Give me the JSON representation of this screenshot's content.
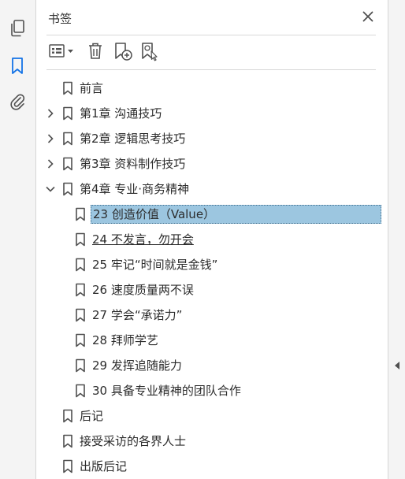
{
  "panel": {
    "title": "书签"
  },
  "rail": {
    "items": [
      {
        "name": "page-thumbnails",
        "icon": "pages-icon"
      },
      {
        "name": "bookmarks",
        "icon": "bookmark-icon",
        "active": true
      },
      {
        "name": "attachments",
        "icon": "paperclip-icon"
      }
    ]
  },
  "toolbar": {
    "items": [
      "options-menu-icon",
      "delete-icon",
      "new-bookmark-icon",
      "bookmark-from-structure-icon"
    ]
  },
  "bookmarks": [
    {
      "label": "前言",
      "level": 0,
      "expander": "none"
    },
    {
      "label": "第1章 沟通技巧",
      "level": 0,
      "expander": "collapsed"
    },
    {
      "label": "第2章 逻辑思考技巧",
      "level": 0,
      "expander": "collapsed"
    },
    {
      "label": "第3章 资料制作技巧",
      "level": 0,
      "expander": "collapsed"
    },
    {
      "label": "第4章 专业·商务精神",
      "level": 0,
      "expander": "expanded"
    },
    {
      "label": "23 创造价值（Value）",
      "level": 1,
      "expander": "none",
      "selected": true
    },
    {
      "label": "24 不发言，勿开会",
      "level": 1,
      "expander": "none",
      "hovered": true
    },
    {
      "label": "25 牢记“时间就是金钱”",
      "level": 1,
      "expander": "none"
    },
    {
      "label": "26 速度质量两不误",
      "level": 1,
      "expander": "none"
    },
    {
      "label": "27 学会“承诺力”",
      "level": 1,
      "expander": "none"
    },
    {
      "label": "28 拜师学艺",
      "level": 1,
      "expander": "none"
    },
    {
      "label": "29 发挥追随能力",
      "level": 1,
      "expander": "none"
    },
    {
      "label": "30 具备专业精神的团队合作",
      "level": 1,
      "expander": "none"
    },
    {
      "label": "后记",
      "level": 0,
      "expander": "none"
    },
    {
      "label": "接受采访的各界人士",
      "level": 0,
      "expander": "none"
    },
    {
      "label": "出版后记",
      "level": 0,
      "expander": "none"
    }
  ],
  "colors": {
    "accent": "#1473e6",
    "selection": "#9cc6e0",
    "icon": "#505050"
  }
}
